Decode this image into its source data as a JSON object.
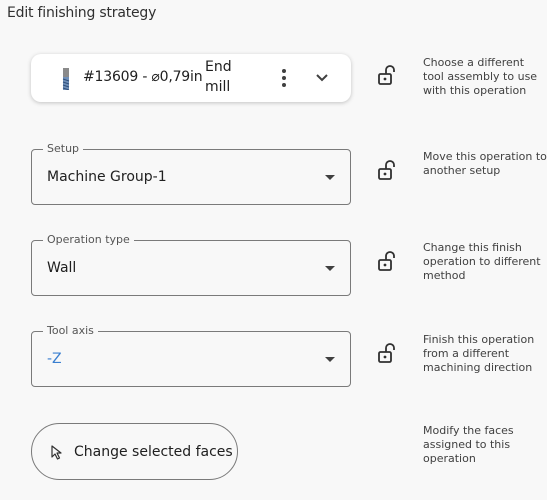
{
  "header": {
    "title": "Edit finishing strategy"
  },
  "tool": {
    "icon": "end-mill-icon",
    "name": "#13609 - ⌀0,79in",
    "type": "End mill",
    "more_icon": "more-vert-icon",
    "expand_icon": "chevron-down-icon",
    "help": "Choose a different tool assembly to use with this operation"
  },
  "setup": {
    "label": "Setup",
    "value": "Machine Group-1",
    "help": "Move this operation to another setup"
  },
  "operation_type": {
    "label": "Operation type",
    "value": "Wall",
    "help": "Change this finish operation to different method"
  },
  "tool_axis": {
    "label": "Tool axis",
    "value": "-Z",
    "help": "Finish this operation from a different machining direction"
  },
  "faces": {
    "button_label": "Change selected faces",
    "icon": "cursor-icon",
    "help": "Modify the faces assigned to this operation"
  },
  "lock_icon": "unlock-icon",
  "colors": {
    "accent": "#3a7fd0",
    "border": "#7a7a7a",
    "background": "#f8f8f8"
  }
}
